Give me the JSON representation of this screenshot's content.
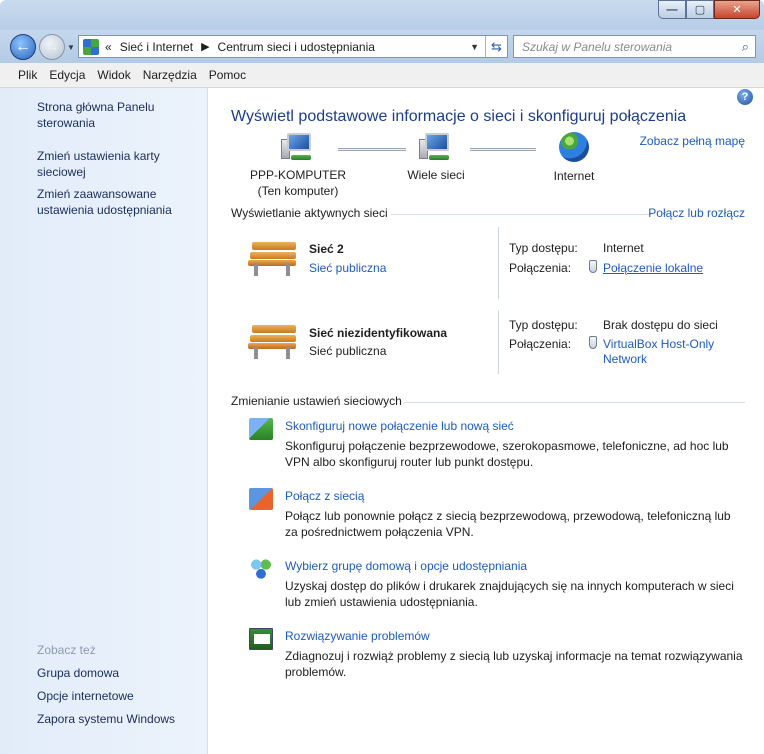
{
  "window": {
    "min_glyph": "—",
    "max_glyph": "▢",
    "close_glyph": "✕"
  },
  "address": {
    "crumb_sep": "«",
    "crumbs": [
      "Sieć i Internet",
      "Centrum sieci i udostępniania"
    ],
    "crumb_arrow": "▶",
    "search_placeholder": "Szukaj w Panelu sterowania"
  },
  "menu": [
    "Plik",
    "Edycja",
    "Widok",
    "Narzędzia",
    "Pomoc"
  ],
  "sidebar": {
    "home_link": "Strona główna Panelu sterowania",
    "links": [
      "Zmień ustawienia karty sieciowej",
      "Zmień zaawansowane ustawienia udostępniania"
    ],
    "see_also_title": "Zobacz też",
    "see_also": [
      "Grupa domowa",
      "Opcje internetowe",
      "Zapora systemu Windows"
    ]
  },
  "main": {
    "title": "Wyświetl podstawowe informacje o sieci i skonfiguruj połączenia",
    "full_map_link": "Zobacz pełną mapę",
    "map": {
      "computer": "PPP-KOMPUTER",
      "computer_sub": "(Ten komputer)",
      "multiple": "Wiele sieci",
      "internet": "Internet"
    },
    "active_header": "Wyświetlanie aktywnych sieci",
    "connect_link": "Połącz lub rozłącz",
    "networks": [
      {
        "name": "Sieć  2",
        "type": "Sieć publiczna",
        "access_label": "Typ dostępu:",
        "access_value": "Internet",
        "conn_label": "Połączenia:",
        "conn_value": "Połączenie lokalne"
      },
      {
        "name": "Sieć niezidentyfikowana",
        "type": "Sieć publiczna",
        "access_label": "Typ dostępu:",
        "access_value": "Brak dostępu do sieci",
        "conn_label": "Połączenia:",
        "conn_value_line1": "VirtualBox Host-Only",
        "conn_value_line2": "Network"
      }
    ],
    "change_header": "Zmienianie ustawień sieciowych",
    "tasks": [
      {
        "title": "Skonfiguruj nowe połączenie lub nową sieć",
        "desc": "Skonfiguruj połączenie bezprzewodowe, szerokopasmowe, telefoniczne, ad hoc lub VPN albo skonfiguruj router lub punkt dostępu."
      },
      {
        "title": "Połącz z siecią",
        "desc": "Połącz lub ponownie połącz z siecią bezprzewodową, przewodową, telefoniczną lub za pośrednictwem połączenia VPN."
      },
      {
        "title": "Wybierz grupę domową i opcje udostępniania",
        "desc": "Uzyskaj dostęp do plików i drukarek znajdujących się na innych komputerach w sieci lub zmień ustawienia udostępniania."
      },
      {
        "title": "Rozwiązywanie problemów",
        "desc": "Zdiagnozuj i rozwiąż problemy z siecią lub uzyskaj informacje na temat rozwiązywania problemów."
      }
    ]
  },
  "icons": {
    "help": "?",
    "search": "⌕",
    "refresh": "⇆",
    "dropdown": "▼",
    "back": "←",
    "forward": "→"
  }
}
